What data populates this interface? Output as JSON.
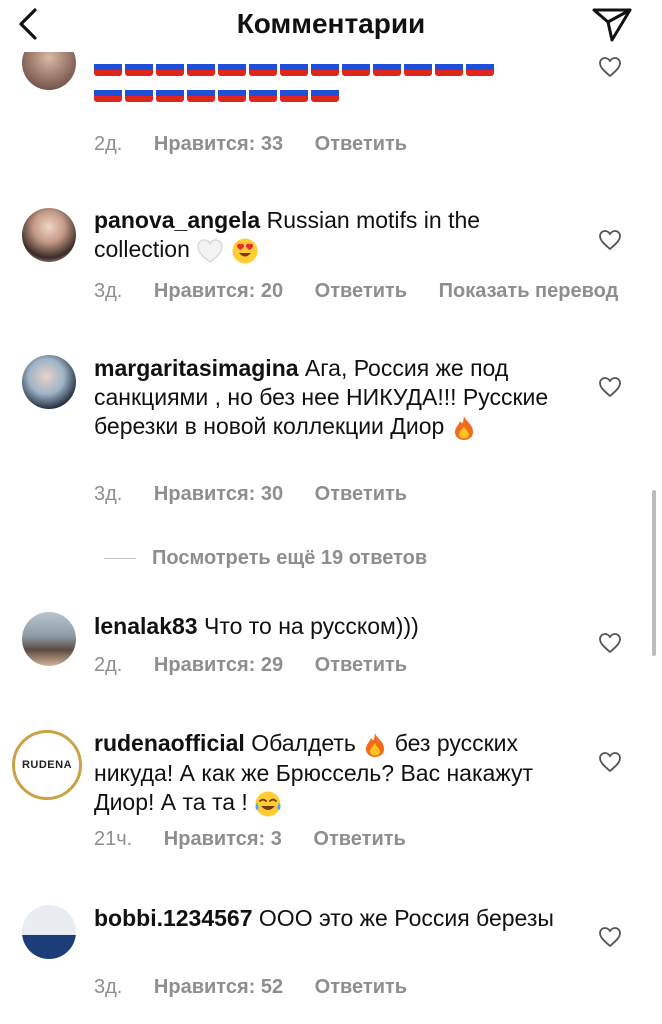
{
  "header": {
    "title": "Комментарии"
  },
  "actions": {
    "reply_label": "Ответить",
    "translate_label": "Показать перевод"
  },
  "comments": [
    {
      "meta": {
        "time": "2д.",
        "likes": "Нравится: 33"
      }
    },
    {
      "username": "panova_angela",
      "text": "Russian motifs in the collection",
      "meta": {
        "time": "3д.",
        "likes": "Нравится: 20"
      }
    },
    {
      "username": "margaritasimagina",
      "text": "Ага, Россия же под санкциями , но без нее НИКУДА!!! Русские березки в новой коллекции Диор",
      "meta": {
        "time": "3д.",
        "likes": "Нравится: 30"
      }
    },
    {
      "username": "lenalak83",
      "text": "Что то на русском)))",
      "meta": {
        "time": "2д.",
        "likes": "Нравится: 29"
      }
    },
    {
      "username": "rudenaofficial",
      "text_part1": "Обалдеть",
      "text_part2": "без русских никуда! А как же Брюссель? Вас накажут Диор! А та та !",
      "avatar_text": "RUDENA",
      "meta": {
        "time": "21ч.",
        "likes": "Нравится: 3"
      }
    },
    {
      "username": "bobbi.1234567",
      "text": "ООО это же Россия березы",
      "meta": {
        "time": "3д.",
        "likes": "Нравится: 52"
      }
    }
  ],
  "view_more_replies": "Посмотреть ещё 19 ответов",
  "colors": {
    "text": "#111111",
    "secondary": "#8e8e8e",
    "flag_blue": "#1e4fd8",
    "flag_red": "#e0261b"
  }
}
